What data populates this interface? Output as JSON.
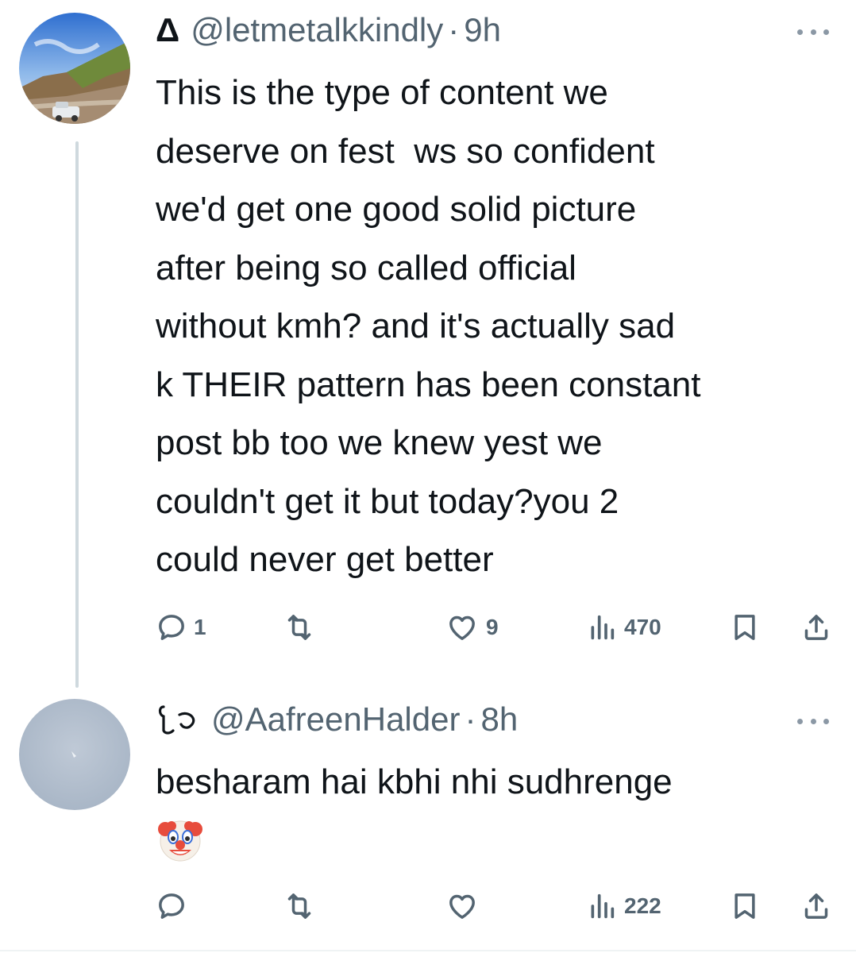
{
  "tweets": [
    {
      "display_name": "Δ",
      "handle": "@letmetalkkindly",
      "separator": "·",
      "time": "9h",
      "text": "This is the type of content we\ndeserve on fest  ws so confident\nwe'd get one good solid picture\nafter being so called official\nwithout kmh? and it's actually sad\nk THEIR pattern has been constant\npost bb too we knew yest we\ncouldn't get it but today?you 2\ncould never get better",
      "replies": "1",
      "reposts": "",
      "likes": "9",
      "views": "470"
    },
    {
      "display_name": "⁠",
      "handle": "@AafreenHalder",
      "separator": "·",
      "time": "8h",
      "text": "besharam hai kbhi nhi sudhrenge",
      "emoji": "🤡",
      "replies": "",
      "reposts": "",
      "likes": "",
      "views": "222"
    }
  ],
  "colors": {
    "text_primary": "#0f1419",
    "text_secondary": "#536471",
    "thread_line": "#cfd9de"
  },
  "icons": [
    "reply-icon",
    "repost-icon",
    "like-icon",
    "views-icon",
    "bookmark-icon",
    "share-icon",
    "more-icon"
  ]
}
